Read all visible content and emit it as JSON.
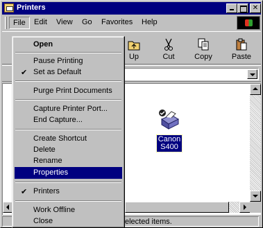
{
  "window": {
    "title": "Printers"
  },
  "menubar": {
    "items": [
      "File",
      "Edit",
      "View",
      "Go",
      "Favorites",
      "Help"
    ]
  },
  "toolbar": {
    "buttons": [
      {
        "label": "Up",
        "icon": "up-folder-icon"
      },
      {
        "label": "Cut",
        "icon": "scissors-icon"
      },
      {
        "label": "Copy",
        "icon": "copy-icon"
      },
      {
        "label": "Paste",
        "icon": "paste-icon"
      }
    ]
  },
  "file_menu": {
    "items": [
      {
        "label": "Open",
        "bold": true
      },
      {
        "label": "Pause Printing"
      },
      {
        "label": "Set as Default",
        "checked": true
      },
      {
        "label": "Purge Print Documents"
      },
      {
        "label": "Capture Printer Port..."
      },
      {
        "label": "End Capture..."
      },
      {
        "label": "Create Shortcut"
      },
      {
        "label": "Delete"
      },
      {
        "label": "Rename"
      },
      {
        "label": "Properties",
        "selected": true
      },
      {
        "label": "Printers",
        "checked": true
      },
      {
        "label": "Work Offline"
      },
      {
        "label": "Close"
      }
    ]
  },
  "content": {
    "printer": {
      "label_line1": "Canon",
      "label_line2": "S400",
      "icon": "printer-icon"
    }
  },
  "statusbar": {
    "text": "elected items."
  },
  "colors": {
    "title_bar": "#000080",
    "selection": "#000080",
    "face": "#c0c0c0"
  }
}
